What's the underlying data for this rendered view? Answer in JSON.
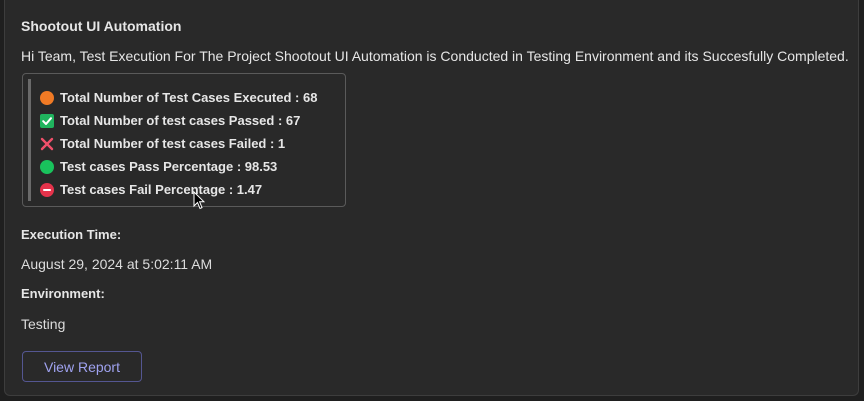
{
  "card": {
    "title": "Shootout UI Automation",
    "intro": "Hi Team, Test Execution For The Project Shootout UI Automation is Conducted in Testing Environment and its Succesfully Completed.",
    "summary": [
      {
        "icon": "orange-circle-icon",
        "text": "Total Number of Test Cases Executed : 68"
      },
      {
        "icon": "check-box-icon",
        "text": "Total Number of test cases Passed : 67"
      },
      {
        "icon": "red-cross-icon",
        "text": "Total Number of test cases Failed : 1"
      },
      {
        "icon": "green-circle-icon",
        "text": "Test cases Pass Percentage : 98.53"
      },
      {
        "icon": "no-entry-icon",
        "text": "Test cases Fail Percentage : 1.47"
      }
    ],
    "execution_time_label": "Execution Time:",
    "execution_time_value": "August 29, 2024 at 5:02:11 AM",
    "environment_label": "Environment:",
    "environment_value": "Testing",
    "view_report_label": "View Report"
  },
  "colors": {
    "background": "#292929",
    "text": "#e6e6e6",
    "accent": "#9fa2f0",
    "passed": "#20b45e",
    "failed": "#e5334b",
    "executed": "#f07a25"
  }
}
